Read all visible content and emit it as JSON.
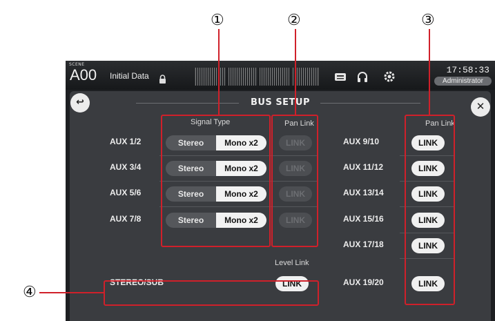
{
  "callouts": [
    "①",
    "②",
    "③",
    "④"
  ],
  "topbar": {
    "scene_tag": "SCENE",
    "scene_number": "A00",
    "scene_name": "Initial Data",
    "time": "17:58:33",
    "user": "Administrator"
  },
  "panel": {
    "title": "BUS SETUP",
    "back_label": "↩",
    "close_label": "✕",
    "signal_type_header": "Signal Type",
    "pan_link_header_left": "Pan Link",
    "pan_link_header_right": "Pan Link",
    "level_link_header": "Level Link",
    "stereo_label": "Stereo",
    "mono_label": "Mono x2",
    "link_label": "LINK",
    "left_rows": [
      {
        "label": "AUX 1/2",
        "signal": "Mono x2",
        "pan_link_enabled": false
      },
      {
        "label": "AUX 3/4",
        "signal": "Mono x2",
        "pan_link_enabled": false
      },
      {
        "label": "AUX 5/6",
        "signal": "Mono x2",
        "pan_link_enabled": false
      },
      {
        "label": "AUX 7/8",
        "signal": "Mono x2",
        "pan_link_enabled": false
      }
    ],
    "right_rows": [
      {
        "label": "AUX 9/10"
      },
      {
        "label": "AUX 11/12"
      },
      {
        "label": "AUX 13/14"
      },
      {
        "label": "AUX 15/16"
      },
      {
        "label": "AUX 17/18"
      },
      {
        "label": "AUX 19/20"
      }
    ],
    "stereo_sub_label": "STEREO/SUB"
  },
  "colors": {
    "callout_red": "#d0202a",
    "panel_bg": "#3a3c40",
    "button_on": "#f0f0f0"
  }
}
